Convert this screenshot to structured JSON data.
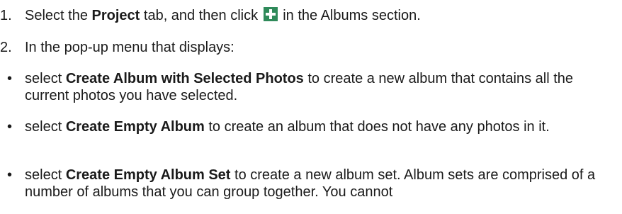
{
  "steps": [
    {
      "number": "1.",
      "pre": "Select the ",
      "bold": "Project",
      "mid": " tab, and then click ",
      "icon": "plus-icon",
      "post": " in the Albums section."
    },
    {
      "number": "2.",
      "text": "In the pop-up menu that displays:"
    }
  ],
  "bullets": [
    {
      "marker": "•",
      "pre": "select ",
      "bold": "Create Album with Selected Photos",
      "post": " to create a new album that contains all the current photos you have selected."
    },
    {
      "marker": "•",
      "pre": "select ",
      "bold": "Create Empty Album",
      "post": " to create an album that does not have any photos in it."
    },
    {
      "marker": "•",
      "pre": "select ",
      "bold": "Create Empty Album Set",
      "post": " to create a new album set. Album sets are comprised of a number of albums that you can group together. You cannot"
    }
  ],
  "colors": {
    "icon_green": "#2f8a5a",
    "text": "#1a1a1a"
  }
}
